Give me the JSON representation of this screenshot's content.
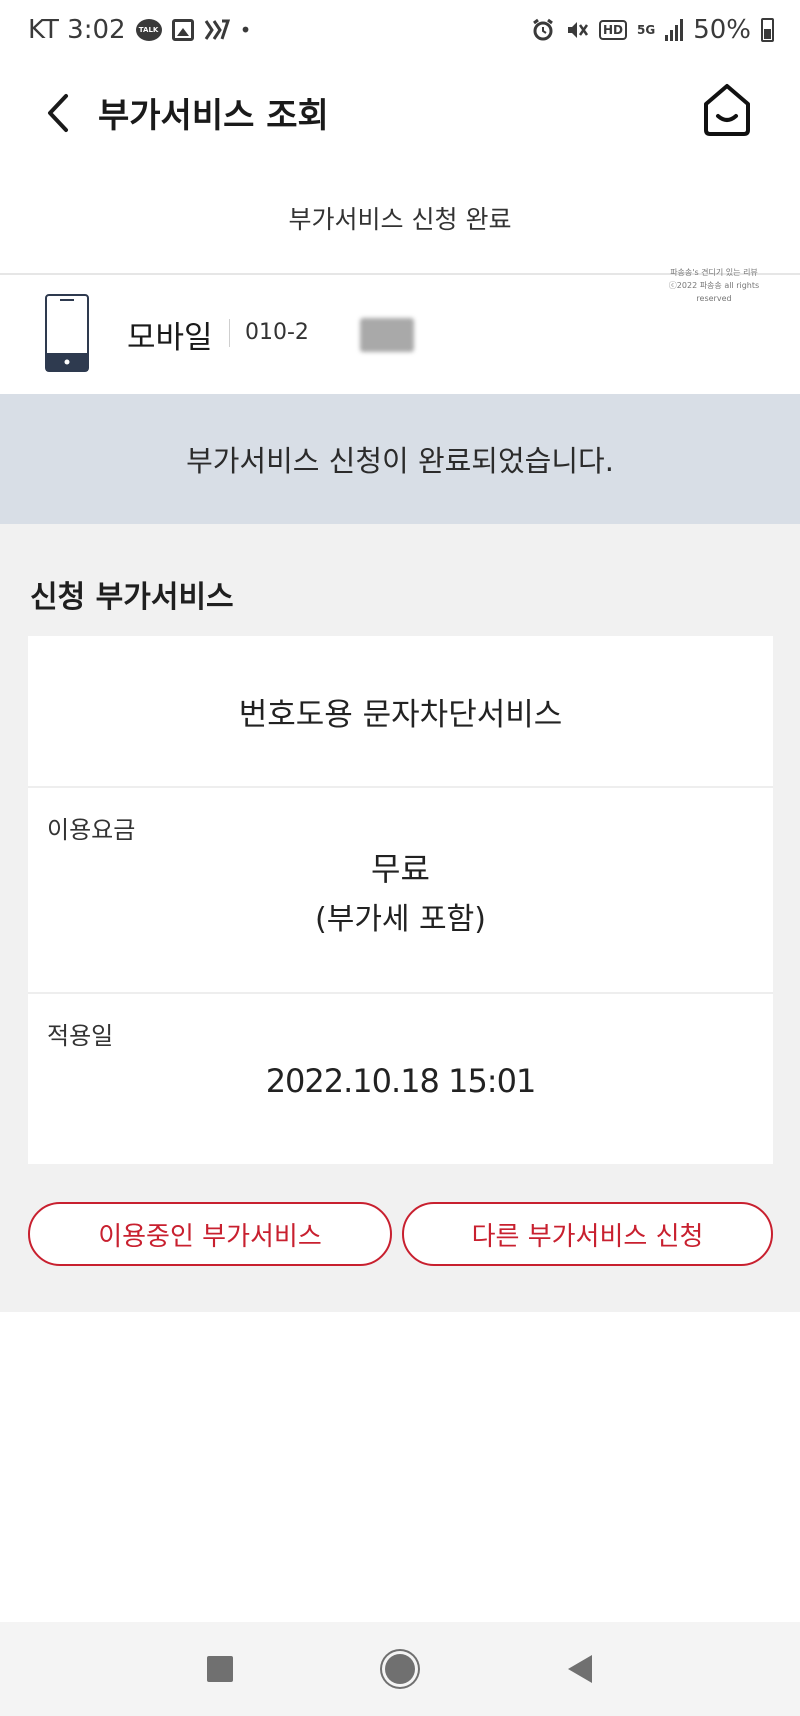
{
  "status_bar": {
    "carrier_time": "KT 3:02",
    "talk_icon_text": "TALK",
    "dot": "•",
    "hd_label": "HD",
    "network_label": "5G",
    "battery": "50%"
  },
  "header": {
    "title": "부가서비스 조회",
    "back_icon": "chevron-left-icon",
    "home_icon": "home-icon"
  },
  "subtitle": "부가서비스 신청 완료",
  "watermark": {
    "line1": "파송송's 견디기 있는 리뷰",
    "line2": "ⓒ2022 파송송 all rights reserved"
  },
  "device": {
    "label": "모바일",
    "number": "010-2",
    "icon": "mobile-phone-icon"
  },
  "banner": "부가서비스 신청이 완료되었습니다.",
  "section_title": "신청 부가서비스",
  "service": {
    "name": "번호도용 문자차단서비스",
    "fee_label": "이용요금",
    "fee_value": "무료",
    "fee_note": "(부가세 포함)",
    "date_label": "적용일",
    "date_value": "2022.10.18 15:01"
  },
  "buttons": {
    "in_use": "이용중인 부가서비스",
    "other": "다른 부가서비스 신청"
  },
  "colors": {
    "accent": "#c8202f",
    "banner_bg": "#d8dee6",
    "content_bg": "#f1f1f1"
  },
  "nav": {
    "recent_icon": "square-icon",
    "home_icon": "circle-home-icon",
    "back_icon": "triangle-back-icon"
  }
}
